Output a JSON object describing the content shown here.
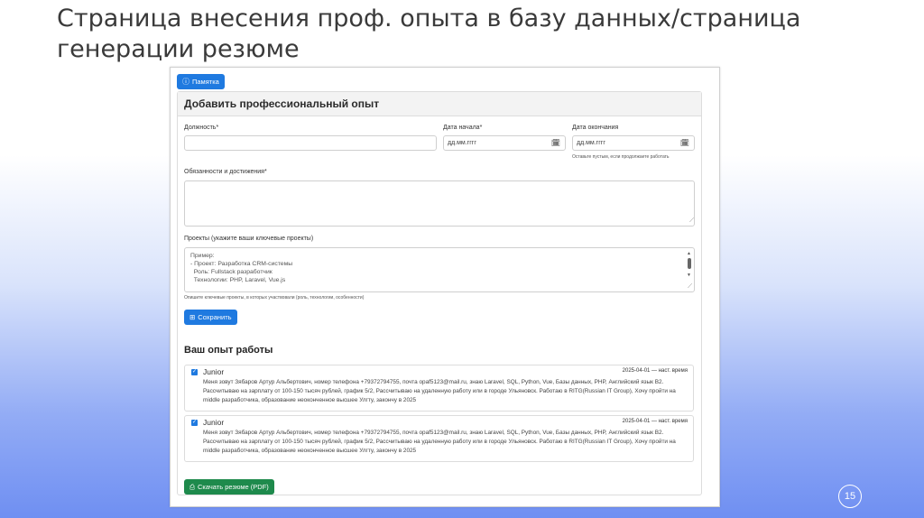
{
  "slide": {
    "title_line1": "Страница внесения проф. опыта в базу данных/страница",
    "title_line2": "генерации резюме",
    "page_number": "15"
  },
  "app": {
    "memo_button": "Памятка",
    "card_title": "Добавить профессиональный опыт",
    "form": {
      "position_label": "Должность*",
      "position_value": "",
      "start_date_label": "Дата начала*",
      "start_date_placeholder": "дд.мм.гггг",
      "end_date_label": "Дата окончания",
      "end_date_placeholder": "дд.мм.гггг",
      "end_date_hint": "Оставьте пустым, если продолжаете работать",
      "duties_label": "Обязанности и достижения*",
      "duties_value": "",
      "projects_label": "Проекты (укажите ваши ключевые проекты)",
      "projects_placeholder_lines": [
        "Пример:",
        "- Проект: Разработка CRM-системы",
        "  Роль: Fullstack разработчик",
        "  Технологии: PHP, Laravel, Vue.js"
      ],
      "projects_hint": "Опишите ключевые проекты, в которых участвовали (роль, технологии, особенности)",
      "save_button": "Сохранить"
    },
    "experience_section_title": "Ваш опыт работы",
    "experience_items": [
      {
        "checked": true,
        "title": "Junior",
        "date": "2025-04-01 — наст. время",
        "description": "Меня зовут Зябаров Артур Альбертович, номер телефона +79372794755, почта opaf5123@mail.ru, знаю Laravel, SQL, Python, Vue, Базы данных, PHP, Английский язык B2. Рассчитываю на зарплату от 100-150 тысяч рублей, график 5/2, Рассчитываю на удаленную работу или в городе Ульяновск. Работаю в RITG(Russian IT Group), Хочу пройти на middle разработчика, образование неоконченное высшее Улгту, закончу в 2025"
      },
      {
        "checked": true,
        "title": "Junior",
        "date": "2025-04-01 — наст. время",
        "description": "Меня зовут Зябаров Артур Альбертович, номер телефона +79372794755, почта opaf5123@mail.ru, знаю Laravel, SQL, Python, Vue, Базы данных, PHP, Английский язык B2. Рассчитываю на зарплату от 100-150 тысяч рублей, график 5/2, Рассчитываю на удаленную работу или в городе Ульяновск. Работаю в RITG(Russian IT Group), Хочу пройти на middle разработчика, образование неоконченное высшее Улгту, закончу в 2025"
      }
    ],
    "download_button": "Скачать резюме (PDF)"
  },
  "colors": {
    "primary": "#1f7ae0",
    "success": "#1e8a4c"
  }
}
